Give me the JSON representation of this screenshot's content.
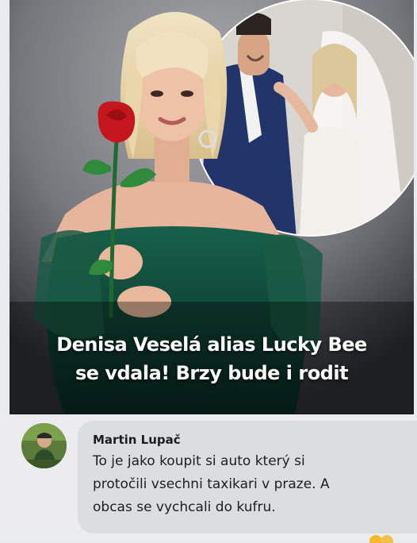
{
  "post": {
    "headline_line1": "Denisa Veselá alias Lucky Bee",
    "headline_line2": "se vdala! Brzy bude i rodit"
  },
  "comment": {
    "author": "Martin Lupač",
    "lines": [
      "To je jako koupit si auto který si",
      "protočili vsechni taxikari v praze. A",
      "obcas se vychcali do kufru."
    ]
  },
  "icons": {
    "avatar": "avatar-photo",
    "reactions": "reaction-icons"
  },
  "colors": {
    "rose": "#c4161c",
    "dress": "#0f4a36",
    "suit": "#22356b",
    "bubble": "#dcdde0"
  }
}
